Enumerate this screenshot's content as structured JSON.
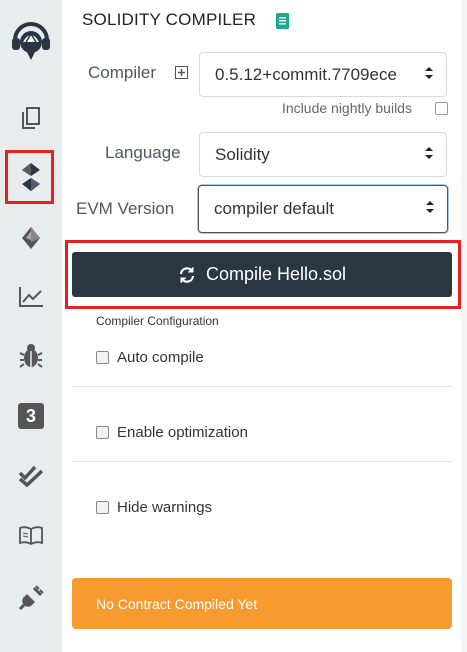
{
  "panel": {
    "title": "SOLIDITY COMPILER",
    "compiler": {
      "label": "Compiler",
      "value": "0.5.12+commit.7709ece"
    },
    "nightly": {
      "label": "Include nightly builds",
      "checked": false
    },
    "language": {
      "label": "Language",
      "value": "Solidity"
    },
    "evm": {
      "label": "EVM Version",
      "value": "compiler default"
    },
    "compile_button": {
      "label": "Compile Hello.sol"
    },
    "config": {
      "heading": "Compiler Configuration",
      "options": [
        {
          "label": "Auto compile",
          "checked": false
        },
        {
          "label": "Enable optimization",
          "checked": false
        },
        {
          "label": "Hide warnings",
          "checked": false
        }
      ]
    },
    "status": {
      "text": "No Contract Compiled Yet",
      "color": "#f79a2f"
    }
  },
  "sidebar": {
    "icons": [
      "remix-logo-icon",
      "file-explorer-icon",
      "solidity-compiler-icon",
      "deploy-run-icon",
      "analysis-icon",
      "debugger-icon",
      "step-3-icon",
      "testing-icon",
      "docs-icon",
      "plugin-manager-icon"
    ],
    "active": "solidity-compiler-icon",
    "step_badge": "3"
  },
  "colors": {
    "sidebar_bg": "#e8eced",
    "button_dark": "#2b3643",
    "highlight": "#e32323",
    "status_orange": "#f79a2f",
    "doc_green": "#1aab8a"
  }
}
